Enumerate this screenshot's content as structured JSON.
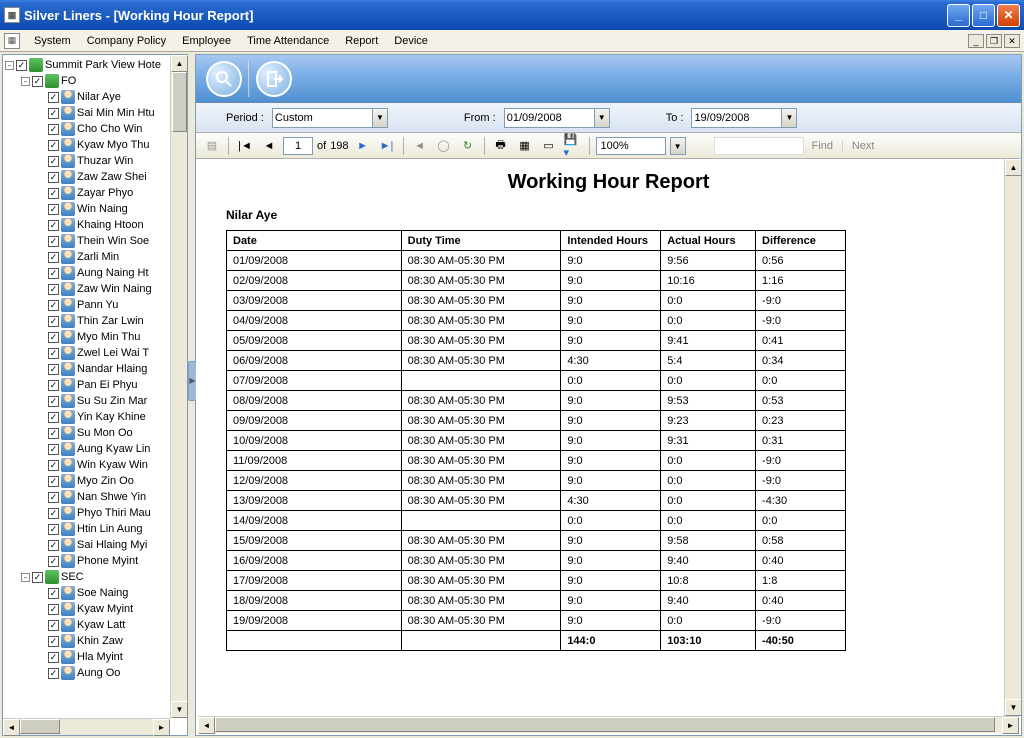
{
  "window": {
    "title": "Silver Liners - [Working Hour Report]"
  },
  "menu": {
    "items": [
      "System",
      "Company Policy",
      "Employee",
      "Time Attendance",
      "Report",
      "Device"
    ]
  },
  "tree": {
    "root": "Summit Park View Hote",
    "groups": [
      {
        "name": "FO",
        "members": [
          "Nilar Aye",
          "Sai Min Min Htu",
          "Cho Cho Win",
          "Kyaw Myo Thu",
          "Thuzar Win",
          "Zaw Zaw Shei",
          "Zayar Phyo",
          "Win Naing",
          "Khaing Htoon",
          "Thein Win Soe",
          "Zarli Min",
          "Aung Naing Ht",
          "Zaw Win Naing",
          "Pann Yu",
          "Thin Zar Lwin",
          "Myo Min Thu",
          "Zwel Lei Wai T",
          "Nandar Hlaing",
          "Pan Ei Phyu",
          "Su Su Zin Mar",
          "Yin Kay Khine",
          "Su Mon Oo",
          "Aung Kyaw Lin",
          "Win Kyaw Win",
          "Myo Zin Oo",
          "Nan Shwe Yin",
          "Phyo Thiri Mau",
          "Htin Lin Aung",
          "Sai Hlaing Myi",
          "Phone Myint"
        ]
      },
      {
        "name": "SEC",
        "members": [
          "Soe Naing",
          "Kyaw Myint",
          "Kyaw Latt",
          "Khin Zaw",
          "Hla Myint",
          "Aung Oo"
        ]
      }
    ]
  },
  "filters": {
    "period_label": "Period :",
    "period_value": "Custom",
    "from_label": "From :",
    "from_value": "01/09/2008",
    "to_label": "To :",
    "to_value": "19/09/2008"
  },
  "pager": {
    "current": "1",
    "of_label": "of",
    "total": "198",
    "zoom": "100%",
    "find": "Find",
    "next": "Next"
  },
  "report": {
    "title": "Working Hour Report",
    "employee": "Nilar Aye",
    "headers": [
      "Date",
      "Duty Time",
      "Intended Hours",
      "Actual Hours",
      "Difference"
    ],
    "rows": [
      [
        "01/09/2008",
        "08:30 AM-05:30 PM",
        "9:0",
        "9:56",
        "0:56"
      ],
      [
        "02/09/2008",
        "08:30 AM-05:30 PM",
        "9:0",
        "10:16",
        "1:16"
      ],
      [
        "03/09/2008",
        "08:30 AM-05:30 PM",
        "9:0",
        "0:0",
        "-9:0"
      ],
      [
        "04/09/2008",
        "08:30 AM-05:30 PM",
        "9:0",
        "0:0",
        "-9:0"
      ],
      [
        "05/09/2008",
        "08:30 AM-05:30 PM",
        "9:0",
        "9:41",
        "0:41"
      ],
      [
        "06/09/2008",
        "08:30 AM-05:30 PM",
        "4:30",
        "5:4",
        "0:34"
      ],
      [
        "07/09/2008",
        "",
        "0:0",
        "0:0",
        "0:0"
      ],
      [
        "08/09/2008",
        "08:30 AM-05:30 PM",
        "9:0",
        "9:53",
        "0:53"
      ],
      [
        "09/09/2008",
        "08:30 AM-05:30 PM",
        "9:0",
        "9:23",
        "0:23"
      ],
      [
        "10/09/2008",
        "08:30 AM-05:30 PM",
        "9:0",
        "9:31",
        "0:31"
      ],
      [
        "11/09/2008",
        "08:30 AM-05:30 PM",
        "9:0",
        "0:0",
        "-9:0"
      ],
      [
        "12/09/2008",
        "08:30 AM-05:30 PM",
        "9:0",
        "0:0",
        "-9:0"
      ],
      [
        "13/09/2008",
        "08:30 AM-05:30 PM",
        "4:30",
        "0:0",
        "-4:30"
      ],
      [
        "14/09/2008",
        "",
        "0:0",
        "0:0",
        "0:0"
      ],
      [
        "15/09/2008",
        "08:30 AM-05:30 PM",
        "9:0",
        "9:58",
        "0:58"
      ],
      [
        "16/09/2008",
        "08:30 AM-05:30 PM",
        "9:0",
        "9:40",
        "0:40"
      ],
      [
        "17/09/2008",
        "08:30 AM-05:30 PM",
        "9:0",
        "10:8",
        "1:8"
      ],
      [
        "18/09/2008",
        "08:30 AM-05:30 PM",
        "9:0",
        "9:40",
        "0:40"
      ],
      [
        "19/09/2008",
        "08:30 AM-05:30 PM",
        "9:0",
        "0:0",
        "-9:0"
      ]
    ],
    "totals": [
      "",
      "",
      "144:0",
      "103:10",
      "-40:50"
    ]
  }
}
